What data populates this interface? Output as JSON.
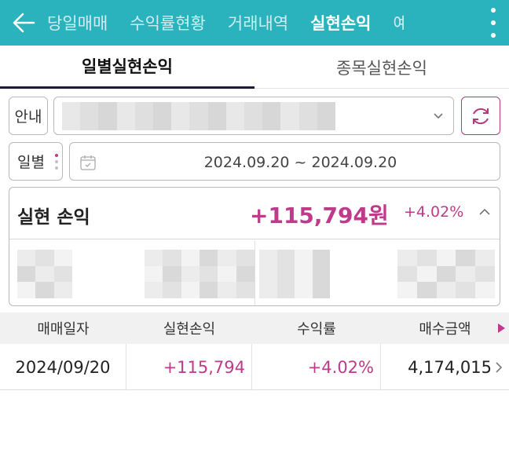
{
  "topbar": {
    "tabs": [
      {
        "label": "당일매매",
        "active": false
      },
      {
        "label": "수익률현황",
        "active": false
      },
      {
        "label": "거래내역",
        "active": false
      },
      {
        "label": "실현손익",
        "active": true
      },
      {
        "label": "예",
        "active": false
      }
    ],
    "bg_color": "#2bb3bd"
  },
  "subtabs": [
    {
      "label": "일별실현손익",
      "active": true
    },
    {
      "label": "종목실현손익",
      "active": false
    }
  ],
  "filters": {
    "account_label": "안내",
    "period_label": "일별",
    "date_range": "2024.09.20 ~ 2024.09.20"
  },
  "summary": {
    "title": "실현 손익",
    "amount": "+115,794원",
    "rate": "+4.02%"
  },
  "table": {
    "headers": [
      "매매일자",
      "실현손익",
      "수익률",
      "매수금액"
    ],
    "rows": [
      {
        "date": "2024/09/20",
        "profit": "+115,794",
        "rate": "+4.02%",
        "buy_amount": "4,174,015"
      }
    ]
  },
  "colors": {
    "accent": "#c0398a",
    "teal": "#2bb3bd"
  }
}
